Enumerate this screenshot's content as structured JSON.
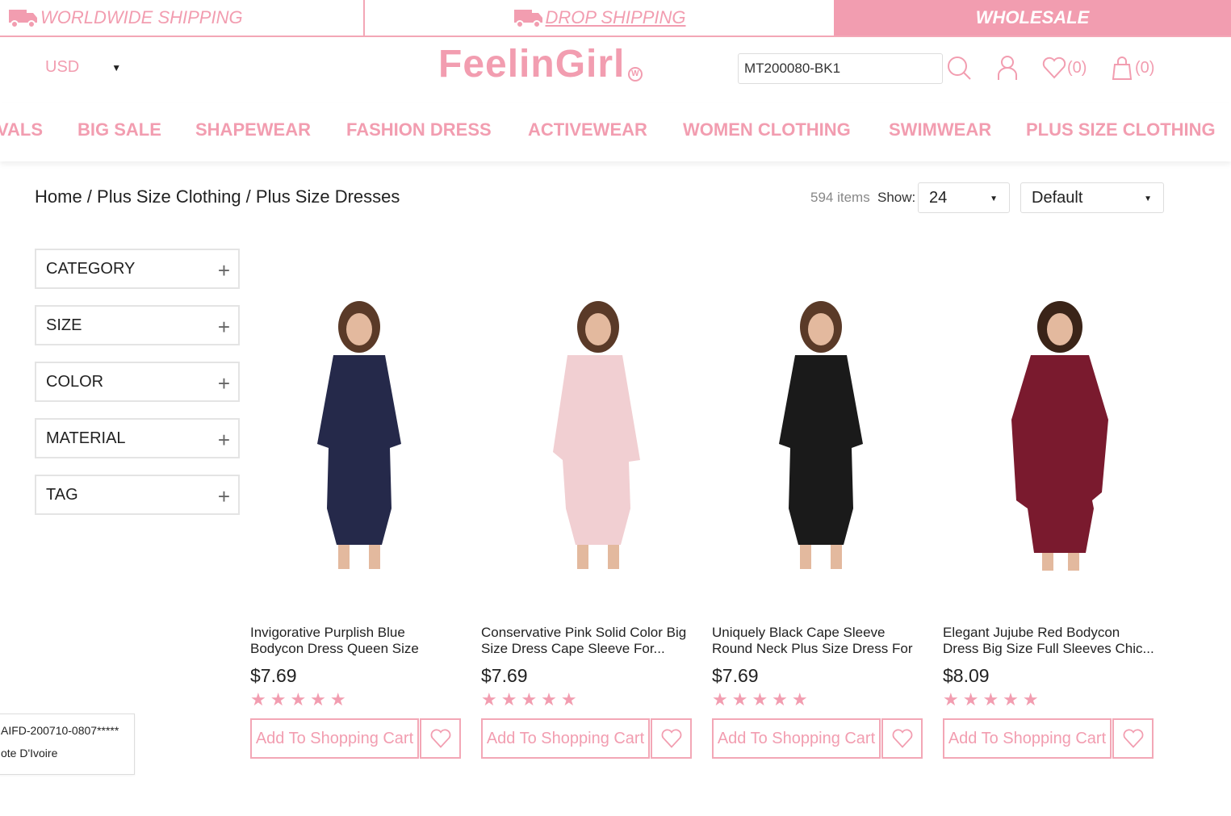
{
  "topbar": {
    "worldwide": "WORLDWIDE SHIPPING",
    "drop": "DROP SHIPPING",
    "wholesale": "WHOLESALE"
  },
  "header": {
    "currency": "USD",
    "logo": "FeelinGirl",
    "search_value": "MT200080-BK1",
    "wishlist_count": "(0)",
    "cart_count": "(0)"
  },
  "nav": [
    "VALS",
    "BIG SALE",
    "SHAPEWEAR",
    "FASHION DRESS",
    "ACTIVEWEAR",
    "WOMEN CLOTHING",
    "SWIMWEAR",
    "PLUS SIZE CLOTHING"
  ],
  "breadcrumb": "Home / Plus Size Clothing / Plus Size Dresses",
  "listing": {
    "items_count": "594 items",
    "show_label": "Show:",
    "per_page": "24",
    "sort": "Default"
  },
  "filters": [
    "CATEGORY",
    "SIZE",
    "COLOR",
    "MATERIAL",
    "TAG"
  ],
  "products": [
    {
      "title": "Invigorative Purplish Blue Bodycon Dress Queen Size Round ...",
      "price": "$7.69",
      "rating": 5,
      "dress_color": "#25294a",
      "cart_label": "Add To Shopping Cart"
    },
    {
      "title": "Conservative Pink Solid Color Big Size Dress Cape Sleeve For...",
      "price": "$7.69",
      "rating": 5,
      "dress_color": "#f1cfd2",
      "cart_label": "Add To Shopping Cart"
    },
    {
      "title": "Uniquely Black Cape Sleeve Round Neck Plus Size Dress For ...",
      "price": "$7.69",
      "rating": 5,
      "dress_color": "#1a1a1a",
      "cart_label": "Add To Shopping Cart"
    },
    {
      "title": "Elegant Jujube Red Bodycon Dress Big Size Full Sleeves Chic...",
      "price": "$8.09",
      "rating": 5,
      "dress_color": "#7a1a2e",
      "cart_label": "Add To Shopping Cart"
    }
  ],
  "popup": {
    "line1": "AIFD-200710-0807*****",
    "line2": "ote D'Ivoire"
  },
  "colors": {
    "accent": "#f29db0"
  }
}
